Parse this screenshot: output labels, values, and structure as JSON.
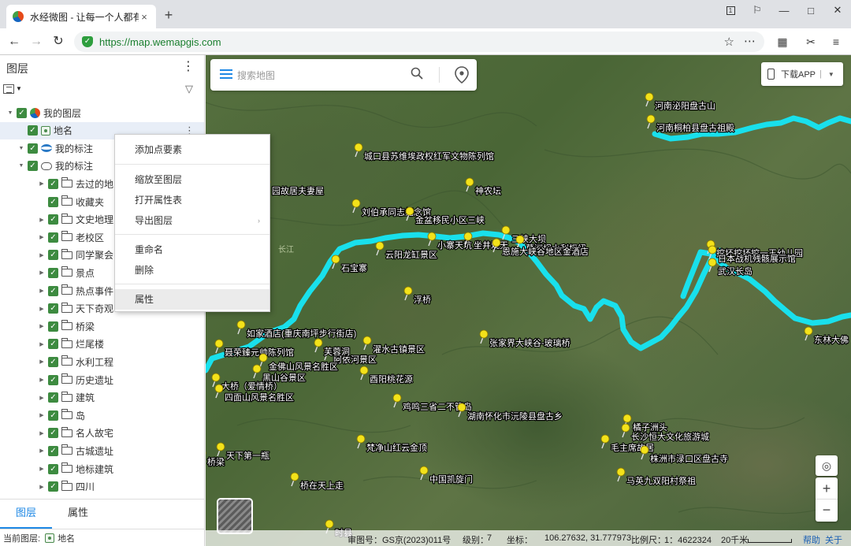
{
  "browser": {
    "tab_title": "水经微图 - 让每一个人都有自",
    "tab_close": "×",
    "new_tab": "+",
    "url_host": "https://map.wemapgis.com",
    "window_badge": "1"
  },
  "panel": {
    "title": "图层",
    "tree": [
      {
        "label": "我的图层",
        "indent": 0,
        "icon": "layer-icon",
        "expand": "▼"
      },
      {
        "label": "地名",
        "indent": 1,
        "icon": "place-icon",
        "expand": "",
        "selected": true
      },
      {
        "label": "我的标注",
        "indent": 1,
        "icon": "marker-icon",
        "expand": "▼"
      },
      {
        "label": "我的标注",
        "indent": 2,
        "icon": "cloud-folder-icon",
        "expand": "▼"
      },
      {
        "label": "去过的地",
        "indent": 3,
        "icon": "folder-icon",
        "expand": "▶"
      },
      {
        "label": "收藏夹",
        "indent": 3,
        "icon": "folder-icon",
        "expand": ""
      },
      {
        "label": "文史地理",
        "indent": 3,
        "icon": "folder-icon",
        "expand": "▶"
      },
      {
        "label": "老校区",
        "indent": 3,
        "icon": "folder-icon",
        "expand": "▶"
      },
      {
        "label": "同学聚会",
        "indent": 3,
        "icon": "folder-icon",
        "expand": "▶"
      },
      {
        "label": "景点",
        "indent": 3,
        "icon": "folder-icon",
        "expand": "▶"
      },
      {
        "label": "热点事件",
        "indent": 3,
        "icon": "folder-icon",
        "expand": "▶"
      },
      {
        "label": "天下奇观",
        "indent": 3,
        "icon": "folder-icon",
        "expand": "▶"
      },
      {
        "label": "桥梁",
        "indent": 3,
        "icon": "folder-icon",
        "expand": "▶"
      },
      {
        "label": "烂尾楼",
        "indent": 3,
        "icon": "folder-icon",
        "expand": "▶"
      },
      {
        "label": "水利工程",
        "indent": 3,
        "icon": "folder-icon",
        "expand": "▶"
      },
      {
        "label": "历史遗址",
        "indent": 3,
        "icon": "folder-icon",
        "expand": "▶"
      },
      {
        "label": "建筑",
        "indent": 3,
        "icon": "folder-icon",
        "expand": "▶"
      },
      {
        "label": "岛",
        "indent": 3,
        "icon": "folder-icon",
        "expand": "▶"
      },
      {
        "label": "名人故宅",
        "indent": 3,
        "icon": "folder-icon",
        "expand": "▶"
      },
      {
        "label": "古城遗址",
        "indent": 3,
        "icon": "folder-icon",
        "expand": "▶"
      },
      {
        "label": "地标建筑",
        "indent": 3,
        "icon": "folder-icon",
        "expand": "▶"
      },
      {
        "label": "四川",
        "indent": 3,
        "icon": "folder-icon",
        "expand": "▶"
      }
    ],
    "tabs": [
      "图层",
      "属性"
    ],
    "current_layer_label": "当前图层:",
    "current_layer": "地名"
  },
  "context_menu": {
    "items": [
      "添加点要素",
      "缩放至图层",
      "打开属性表",
      "导出图层",
      "重命名",
      "删除",
      "属性"
    ],
    "submenu_arrow": "›"
  },
  "map": {
    "search_placeholder": "搜索地图",
    "download_label": "下载APP",
    "download_sep": "|",
    "zoom_in": "+",
    "zoom_out": "−",
    "labels": [
      {
        "text": "河南泌阳盘古山"
      },
      {
        "text": "河南桐柏县盘古祖殿"
      },
      {
        "text": "城口县苏维埃政权红军文物陈列馆"
      },
      {
        "text": "神农坛"
      },
      {
        "text": "园故居夫妻屋"
      },
      {
        "text": "刘伯承同志纪念馆"
      },
      {
        "text": "金盆移民小区三峡"
      },
      {
        "text": "三峡大坝"
      },
      {
        "text": "葛洲坝水利枢纽"
      },
      {
        "text": "云阳龙缸景区"
      },
      {
        "text": "小寨天坑"
      },
      {
        "text": "坐井观天"
      },
      {
        "text": "恩施大峡谷地区金酒店"
      },
      {
        "text": "石宝寨"
      },
      {
        "text": "浮桥"
      },
      {
        "text": "挖坏挖坏挖一王幼儿园"
      },
      {
        "text": "日本战机残骸展示馆"
      },
      {
        "text": "武汉长岛"
      },
      {
        "text": "东林大佛"
      },
      {
        "text": "如家酒店(重庆南坪步行街店)"
      },
      {
        "text": "阿依河景区"
      },
      {
        "text": "濯水古镇景区"
      },
      {
        "text": "张家界大峡谷-玻璃桥"
      },
      {
        "text": "芙蓉洞"
      },
      {
        "text": "聂荣臻元帅陈列馆"
      },
      {
        "text": "金佛山风景名胜区"
      },
      {
        "text": "黑山谷景区"
      },
      {
        "text": "酉阳桃花源"
      },
      {
        "text": "大桥（爱情桥）"
      },
      {
        "text": "四面山风景名胜区"
      },
      {
        "text": "鸡鸣三省二不管岛"
      },
      {
        "text": "湖南怀化市沅陵县盘古乡"
      },
      {
        "text": "橘子洲头"
      },
      {
        "text": "长沙恒大文化旅游城"
      },
      {
        "text": "毛主席故居"
      },
      {
        "text": "株洲市渌口区盘古寺"
      },
      {
        "text": "梵净山红云金顶"
      },
      {
        "text": "天下第一瓶"
      },
      {
        "text": "桥在天上走"
      },
      {
        "text": "中国凯旋门"
      },
      {
        "text": "马英九双阳村祭祖"
      },
      {
        "text": "桥梁"
      },
      {
        "text": "时县"
      }
    ],
    "river_label": "长江",
    "river_color": "#19e0ec",
    "pin_color": "#f3e21a"
  },
  "statusbar": {
    "map_license": "审图号：GS京(2023)011号",
    "level_label": "级别：",
    "level": "7",
    "coord_label": "坐标：",
    "coords": "106.27632, 31.777973",
    "scale_label": "比例尺：",
    "scale": "1：4622324",
    "scale_bar": "20千米",
    "help": "帮助",
    "about": "关于"
  }
}
